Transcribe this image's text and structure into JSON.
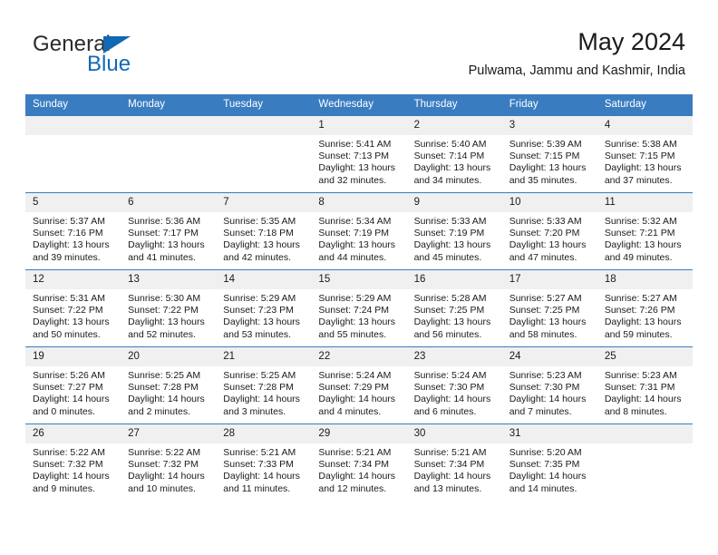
{
  "brand": {
    "name_part1": "General",
    "name_part2": "Blue",
    "accent_color": "#1268b3"
  },
  "header": {
    "title": "May 2024",
    "subtitle": "Pulwama, Jammu and Kashmir, India"
  },
  "theme": {
    "header_row_bg": "#3a7cc0",
    "daynum_bg": "#f0f0f0",
    "text_color": "#1a1a1a"
  },
  "weekday_headers": [
    "Sunday",
    "Monday",
    "Tuesday",
    "Wednesday",
    "Thursday",
    "Friday",
    "Saturday"
  ],
  "weeks": [
    [
      {
        "day": "",
        "empty": true,
        "sunrise": "",
        "sunset": "",
        "daylight_line1": "",
        "daylight_line2": ""
      },
      {
        "day": "",
        "empty": true,
        "sunrise": "",
        "sunset": "",
        "daylight_line1": "",
        "daylight_line2": ""
      },
      {
        "day": "",
        "empty": true,
        "sunrise": "",
        "sunset": "",
        "daylight_line1": "",
        "daylight_line2": ""
      },
      {
        "day": "1",
        "empty": false,
        "sunrise": "Sunrise: 5:41 AM",
        "sunset": "Sunset: 7:13 PM",
        "daylight_line1": "Daylight: 13 hours",
        "daylight_line2": "and 32 minutes."
      },
      {
        "day": "2",
        "empty": false,
        "sunrise": "Sunrise: 5:40 AM",
        "sunset": "Sunset: 7:14 PM",
        "daylight_line1": "Daylight: 13 hours",
        "daylight_line2": "and 34 minutes."
      },
      {
        "day": "3",
        "empty": false,
        "sunrise": "Sunrise: 5:39 AM",
        "sunset": "Sunset: 7:15 PM",
        "daylight_line1": "Daylight: 13 hours",
        "daylight_line2": "and 35 minutes."
      },
      {
        "day": "4",
        "empty": false,
        "sunrise": "Sunrise: 5:38 AM",
        "sunset": "Sunset: 7:15 PM",
        "daylight_line1": "Daylight: 13 hours",
        "daylight_line2": "and 37 minutes."
      }
    ],
    [
      {
        "day": "5",
        "empty": false,
        "sunrise": "Sunrise: 5:37 AM",
        "sunset": "Sunset: 7:16 PM",
        "daylight_line1": "Daylight: 13 hours",
        "daylight_line2": "and 39 minutes."
      },
      {
        "day": "6",
        "empty": false,
        "sunrise": "Sunrise: 5:36 AM",
        "sunset": "Sunset: 7:17 PM",
        "daylight_line1": "Daylight: 13 hours",
        "daylight_line2": "and 41 minutes."
      },
      {
        "day": "7",
        "empty": false,
        "sunrise": "Sunrise: 5:35 AM",
        "sunset": "Sunset: 7:18 PM",
        "daylight_line1": "Daylight: 13 hours",
        "daylight_line2": "and 42 minutes."
      },
      {
        "day": "8",
        "empty": false,
        "sunrise": "Sunrise: 5:34 AM",
        "sunset": "Sunset: 7:19 PM",
        "daylight_line1": "Daylight: 13 hours",
        "daylight_line2": "and 44 minutes."
      },
      {
        "day": "9",
        "empty": false,
        "sunrise": "Sunrise: 5:33 AM",
        "sunset": "Sunset: 7:19 PM",
        "daylight_line1": "Daylight: 13 hours",
        "daylight_line2": "and 45 minutes."
      },
      {
        "day": "10",
        "empty": false,
        "sunrise": "Sunrise: 5:33 AM",
        "sunset": "Sunset: 7:20 PM",
        "daylight_line1": "Daylight: 13 hours",
        "daylight_line2": "and 47 minutes."
      },
      {
        "day": "11",
        "empty": false,
        "sunrise": "Sunrise: 5:32 AM",
        "sunset": "Sunset: 7:21 PM",
        "daylight_line1": "Daylight: 13 hours",
        "daylight_line2": "and 49 minutes."
      }
    ],
    [
      {
        "day": "12",
        "empty": false,
        "sunrise": "Sunrise: 5:31 AM",
        "sunset": "Sunset: 7:22 PM",
        "daylight_line1": "Daylight: 13 hours",
        "daylight_line2": "and 50 minutes."
      },
      {
        "day": "13",
        "empty": false,
        "sunrise": "Sunrise: 5:30 AM",
        "sunset": "Sunset: 7:22 PM",
        "daylight_line1": "Daylight: 13 hours",
        "daylight_line2": "and 52 minutes."
      },
      {
        "day": "14",
        "empty": false,
        "sunrise": "Sunrise: 5:29 AM",
        "sunset": "Sunset: 7:23 PM",
        "daylight_line1": "Daylight: 13 hours",
        "daylight_line2": "and 53 minutes."
      },
      {
        "day": "15",
        "empty": false,
        "sunrise": "Sunrise: 5:29 AM",
        "sunset": "Sunset: 7:24 PM",
        "daylight_line1": "Daylight: 13 hours",
        "daylight_line2": "and 55 minutes."
      },
      {
        "day": "16",
        "empty": false,
        "sunrise": "Sunrise: 5:28 AM",
        "sunset": "Sunset: 7:25 PM",
        "daylight_line1": "Daylight: 13 hours",
        "daylight_line2": "and 56 minutes."
      },
      {
        "day": "17",
        "empty": false,
        "sunrise": "Sunrise: 5:27 AM",
        "sunset": "Sunset: 7:25 PM",
        "daylight_line1": "Daylight: 13 hours",
        "daylight_line2": "and 58 minutes."
      },
      {
        "day": "18",
        "empty": false,
        "sunrise": "Sunrise: 5:27 AM",
        "sunset": "Sunset: 7:26 PM",
        "daylight_line1": "Daylight: 13 hours",
        "daylight_line2": "and 59 minutes."
      }
    ],
    [
      {
        "day": "19",
        "empty": false,
        "sunrise": "Sunrise: 5:26 AM",
        "sunset": "Sunset: 7:27 PM",
        "daylight_line1": "Daylight: 14 hours",
        "daylight_line2": "and 0 minutes."
      },
      {
        "day": "20",
        "empty": false,
        "sunrise": "Sunrise: 5:25 AM",
        "sunset": "Sunset: 7:28 PM",
        "daylight_line1": "Daylight: 14 hours",
        "daylight_line2": "and 2 minutes."
      },
      {
        "day": "21",
        "empty": false,
        "sunrise": "Sunrise: 5:25 AM",
        "sunset": "Sunset: 7:28 PM",
        "daylight_line1": "Daylight: 14 hours",
        "daylight_line2": "and 3 minutes."
      },
      {
        "day": "22",
        "empty": false,
        "sunrise": "Sunrise: 5:24 AM",
        "sunset": "Sunset: 7:29 PM",
        "daylight_line1": "Daylight: 14 hours",
        "daylight_line2": "and 4 minutes."
      },
      {
        "day": "23",
        "empty": false,
        "sunrise": "Sunrise: 5:24 AM",
        "sunset": "Sunset: 7:30 PM",
        "daylight_line1": "Daylight: 14 hours",
        "daylight_line2": "and 6 minutes."
      },
      {
        "day": "24",
        "empty": false,
        "sunrise": "Sunrise: 5:23 AM",
        "sunset": "Sunset: 7:30 PM",
        "daylight_line1": "Daylight: 14 hours",
        "daylight_line2": "and 7 minutes."
      },
      {
        "day": "25",
        "empty": false,
        "sunrise": "Sunrise: 5:23 AM",
        "sunset": "Sunset: 7:31 PM",
        "daylight_line1": "Daylight: 14 hours",
        "daylight_line2": "and 8 minutes."
      }
    ],
    [
      {
        "day": "26",
        "empty": false,
        "sunrise": "Sunrise: 5:22 AM",
        "sunset": "Sunset: 7:32 PM",
        "daylight_line1": "Daylight: 14 hours",
        "daylight_line2": "and 9 minutes."
      },
      {
        "day": "27",
        "empty": false,
        "sunrise": "Sunrise: 5:22 AM",
        "sunset": "Sunset: 7:32 PM",
        "daylight_line1": "Daylight: 14 hours",
        "daylight_line2": "and 10 minutes."
      },
      {
        "day": "28",
        "empty": false,
        "sunrise": "Sunrise: 5:21 AM",
        "sunset": "Sunset: 7:33 PM",
        "daylight_line1": "Daylight: 14 hours",
        "daylight_line2": "and 11 minutes."
      },
      {
        "day": "29",
        "empty": false,
        "sunrise": "Sunrise: 5:21 AM",
        "sunset": "Sunset: 7:34 PM",
        "daylight_line1": "Daylight: 14 hours",
        "daylight_line2": "and 12 minutes."
      },
      {
        "day": "30",
        "empty": false,
        "sunrise": "Sunrise: 5:21 AM",
        "sunset": "Sunset: 7:34 PM",
        "daylight_line1": "Daylight: 14 hours",
        "daylight_line2": "and 13 minutes."
      },
      {
        "day": "31",
        "empty": false,
        "sunrise": "Sunrise: 5:20 AM",
        "sunset": "Sunset: 7:35 PM",
        "daylight_line1": "Daylight: 14 hours",
        "daylight_line2": "and 14 minutes."
      },
      {
        "day": "",
        "empty": true,
        "sunrise": "",
        "sunset": "",
        "daylight_line1": "",
        "daylight_line2": ""
      }
    ]
  ]
}
